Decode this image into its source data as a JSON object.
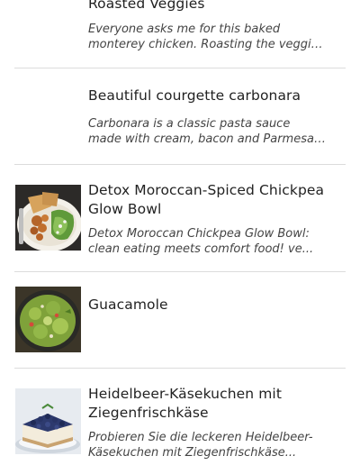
{
  "recipes": [
    {
      "title": "Roasted Veggies",
      "description": "Everyone asks me for this baked monterey chicken. Roasting the veggies first and then baking the chicken...",
      "has_image": false
    },
    {
      "title": "Beautiful courgette carbonara",
      "description": "Carbonara is a classic pasta sauce made with cream, bacon and Parmesan cheese...",
      "has_image": false
    },
    {
      "title": "Detox Moroccan-Spiced Chickpea Glow Bowl",
      "description": "Detox Moroccan Chickpea Glow Bowl: clean eating meets comfort food! ve...",
      "has_image": true,
      "image_icon": "chickpea-bowl-photo"
    },
    {
      "title": "Guacamole",
      "description": "",
      "has_image": true,
      "image_icon": "guacamole-photo"
    },
    {
      "title": "Heidelbeer-Käsekuchen mit Ziegenfrischkäse",
      "description": "Probieren Sie die leckeren Heidelbeer-Käsekuchen mit Ziegenfrischkäse...",
      "has_image": true,
      "image_icon": "blueberry-cheesecake-photo"
    }
  ],
  "colors": {
    "divider": "#dcdcdc",
    "title": "#222222",
    "description": "#444444"
  }
}
